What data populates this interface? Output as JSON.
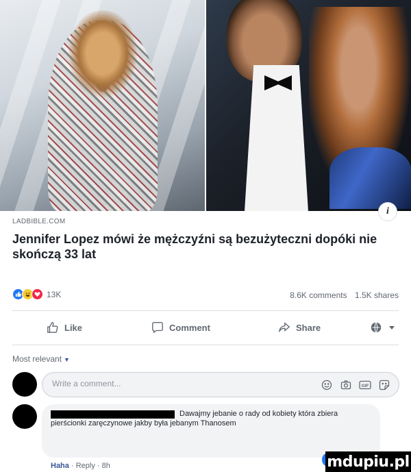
{
  "post": {
    "source": "LADBIBLE.COM",
    "headline": "Jennifer Lopez mówi że mężczyźni są bezużyteczni dopóki nie skończą 33 lat",
    "info_icon": "i"
  },
  "stats": {
    "reaction_icons": [
      "like-icon",
      "haha-icon",
      "love-icon"
    ],
    "reactions_count": "13K",
    "comments": "8.6K comments",
    "shares": "1.5K shares"
  },
  "actions": {
    "like": "Like",
    "comment": "Comment",
    "share": "Share"
  },
  "comments_section": {
    "sort_label": "Most relevant",
    "placeholder": "Write a comment...",
    "input_icons": [
      "emoji-icon",
      "camera-icon",
      "gif-icon",
      "sticker-icon"
    ],
    "first_comment": {
      "text": "Dawajmy jebanie o rady od kobiety która zbiera pierścionki zaręczynowe jakby była jebanym Thanosem",
      "reaction": "Haha",
      "reply": "Reply",
      "time": "8h"
    }
  },
  "watermark": "mdupiu.pl",
  "colors": {
    "link_blue": "#385898",
    "like_blue": "#2078f4",
    "muted_text": "#606770"
  }
}
